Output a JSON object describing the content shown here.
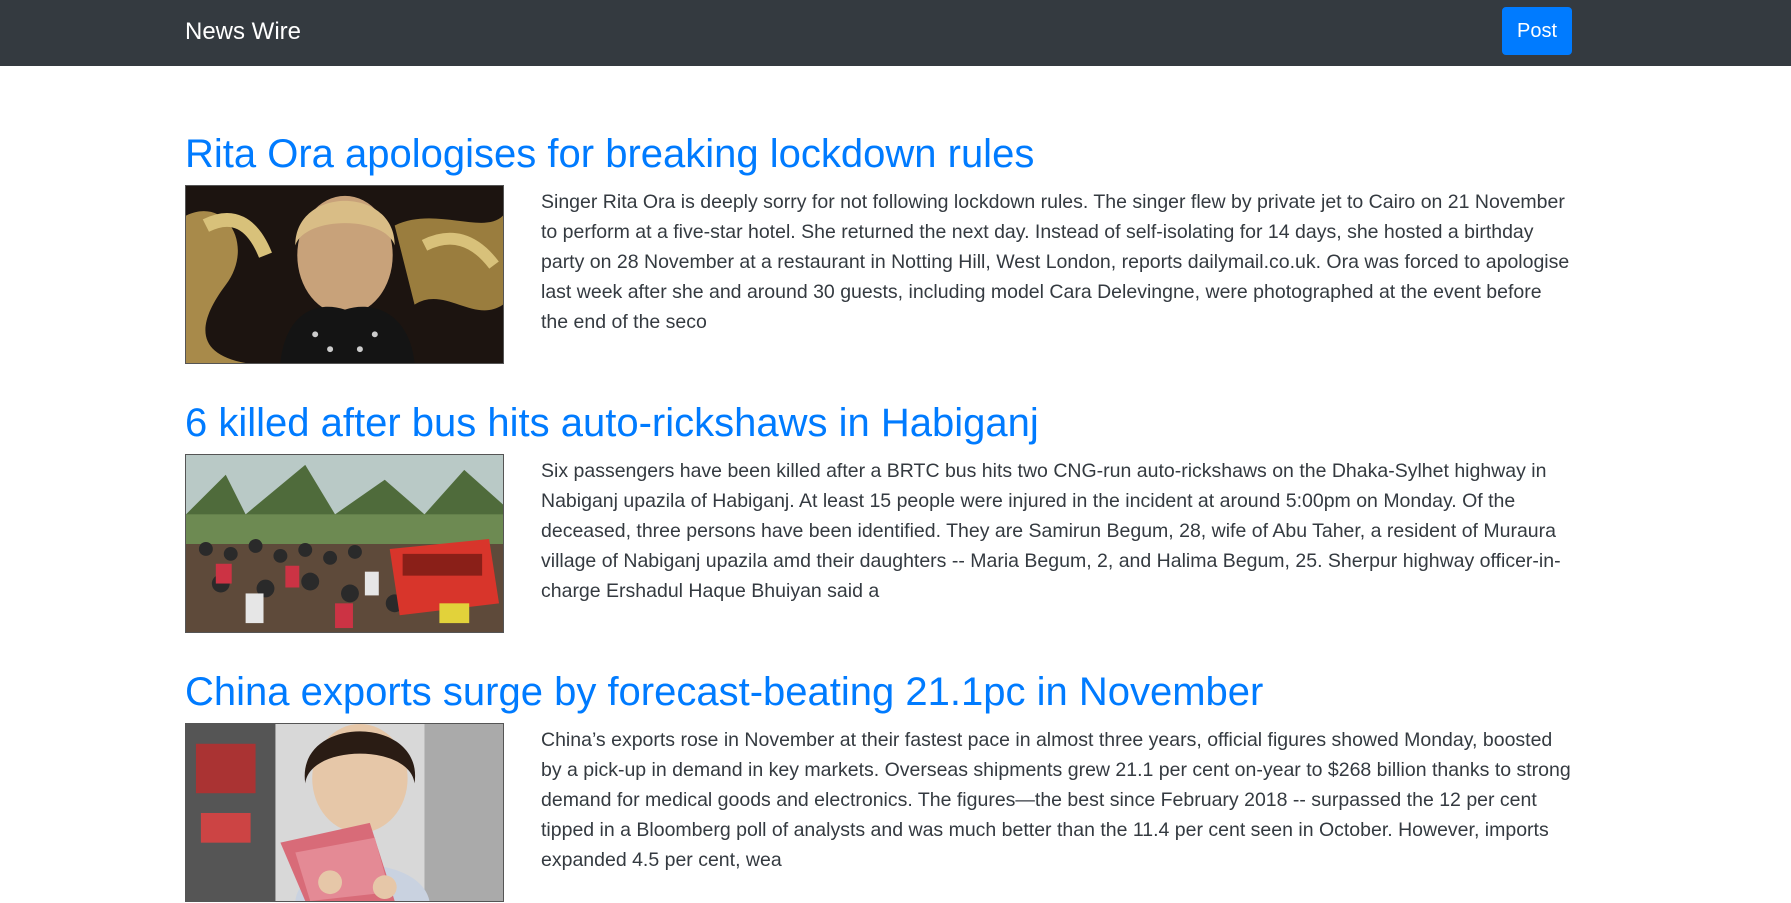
{
  "navbar": {
    "brand": "News Wire",
    "post_label": "Post"
  },
  "articles": [
    {
      "title": "Rita Ora apologises for breaking lockdown rules",
      "summary": "Singer Rita Ora is deeply sorry for not following lockdown rules. The singer flew by private jet to Cairo on 21 November to perform at a five-star hotel. She returned the next day. Instead of self-isolating for 14 days, she hosted a birthday party on 28 November at a restaurant in Notting Hill, West London, reports dailymail.co.uk. Ora was forced to apologise last week after she and around 30 guests, including model Cara Delevingne, were photographed at the event before the end of the seco"
    },
    {
      "title": "6 killed after bus hits auto-rickshaws in Habiganj",
      "summary": "Six passengers have been killed after a BRTC bus hits two CNG-run auto-rickshaws on the Dhaka-Sylhet highway in Nabiganj upazila of Habiganj. At least 15 people were injured in the incident at around 5:00pm on Monday. Of the deceased, three persons have been identified. They are Samirun Begum, 28, wife of Abu Taher, a resident of Muraura village of Nabiganj upazila amd their daughters -- Maria Begum, 2, and Halima Begum, 25. Sherpur highway officer-in-charge Ershadul Haque Bhuiyan said a"
    },
    {
      "title": "China exports surge by forecast-beating 21.1pc in November",
      "summary": "China’s exports rose in November at their fastest pace in almost three years, official figures showed Monday, boosted by a pick-up in demand in key markets. Overseas shipments grew 21.1 per cent on-year to $268 billion thanks to strong demand for medical goods and electronics. The figures—the best since February 2018 -- surpassed the 12 per cent tipped in a Bloomberg poll of analysts and was much better than the 11.4 per cent seen in October. However, imports expanded 4.5 per cent, wea"
    }
  ],
  "colors": {
    "navbar_bg": "#343a40",
    "accent": "#007bff",
    "body_text": "#343a40"
  }
}
